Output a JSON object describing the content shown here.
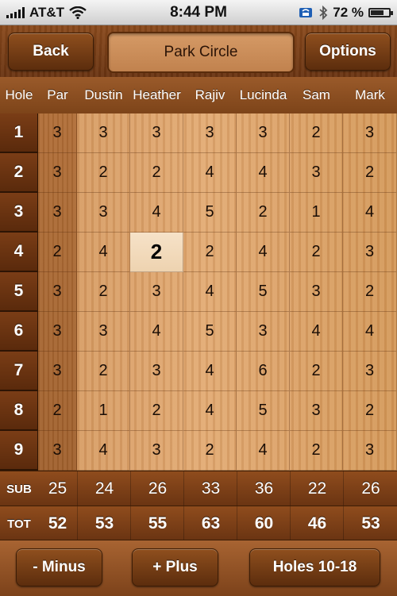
{
  "status": {
    "carrier": "AT&T",
    "time": "8:44 PM",
    "battery": "72 %",
    "battery_level": 0.72
  },
  "nav": {
    "back_label": "Back",
    "title": "Park Circle",
    "options_label": "Options"
  },
  "grid": {
    "hole_header": "Hole",
    "par_header": "Par",
    "players": [
      "Dustin",
      "Heather",
      "Rajiv",
      "Lucinda",
      "Sam",
      "Mark"
    ],
    "rows": [
      {
        "hole": "1",
        "par": "3",
        "scores": [
          "3",
          "3",
          "3",
          "3",
          "2",
          "3"
        ]
      },
      {
        "hole": "2",
        "par": "3",
        "scores": [
          "2",
          "2",
          "4",
          "4",
          "3",
          "2"
        ]
      },
      {
        "hole": "3",
        "par": "3",
        "scores": [
          "3",
          "4",
          "5",
          "2",
          "1",
          "4"
        ]
      },
      {
        "hole": "4",
        "par": "2",
        "scores": [
          "4",
          "2",
          "2",
          "4",
          "2",
          "3"
        ]
      },
      {
        "hole": "5",
        "par": "3",
        "scores": [
          "2",
          "3",
          "4",
          "5",
          "3",
          "2"
        ]
      },
      {
        "hole": "6",
        "par": "3",
        "scores": [
          "3",
          "4",
          "5",
          "3",
          "4",
          "4"
        ]
      },
      {
        "hole": "7",
        "par": "3",
        "scores": [
          "2",
          "3",
          "4",
          "6",
          "2",
          "3"
        ]
      },
      {
        "hole": "8",
        "par": "2",
        "scores": [
          "1",
          "2",
          "4",
          "5",
          "3",
          "2"
        ]
      },
      {
        "hole": "9",
        "par": "3",
        "scores": [
          "4",
          "3",
          "2",
          "4",
          "2",
          "3"
        ]
      }
    ],
    "selected": {
      "row": 3,
      "col": 1
    },
    "sub": {
      "label": "SUB",
      "par": "25",
      "values": [
        "24",
        "26",
        "33",
        "36",
        "22",
        "26"
      ]
    },
    "tot": {
      "label": "TOT",
      "par": "52",
      "values": [
        "53",
        "55",
        "63",
        "60",
        "46",
        "53"
      ]
    }
  },
  "toolbar": {
    "minus_label": "- Minus",
    "plus_label": "+ Plus",
    "holes_label": "Holes 10-18"
  }
}
